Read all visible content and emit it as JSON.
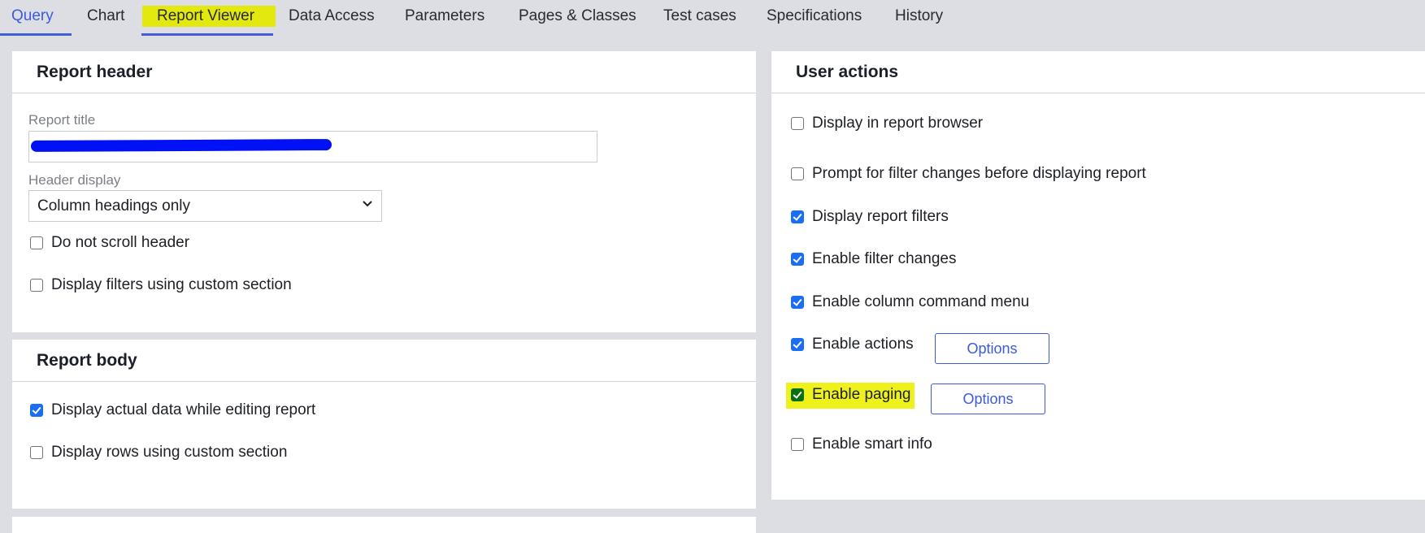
{
  "tabs": [
    {
      "label": "Query",
      "active": true
    },
    {
      "label": "Chart",
      "active": false
    },
    {
      "label": "Report Viewer",
      "active": false,
      "highlighted": true
    },
    {
      "label": "Data Access",
      "active": false
    },
    {
      "label": "Parameters",
      "active": false
    },
    {
      "label": "Pages & Classes",
      "active": false
    },
    {
      "label": "Test cases",
      "active": false
    },
    {
      "label": "Specifications",
      "active": false
    },
    {
      "label": "History",
      "active": false
    }
  ],
  "report_header": {
    "title": "Report header",
    "report_title_label": "Report title",
    "report_title_value": "",
    "header_display_label": "Header display",
    "header_display_value": "Column headings only",
    "checkboxes": [
      {
        "label": "Do not scroll header",
        "checked": false
      },
      {
        "label": "Display filters using custom section",
        "checked": false
      }
    ]
  },
  "report_body": {
    "title": "Report body",
    "checkboxes": [
      {
        "label": "Display actual data while editing report",
        "checked": true
      },
      {
        "label": "Display rows using custom section",
        "checked": false
      }
    ]
  },
  "user_actions": {
    "title": "User actions",
    "checkboxes": [
      {
        "label": "Display in report browser",
        "checked": false
      },
      {
        "label": "Prompt for filter changes before displaying report",
        "checked": false
      },
      {
        "label": "Display report filters",
        "checked": true
      },
      {
        "label": "Enable filter changes",
        "checked": true
      },
      {
        "label": "Enable column command menu",
        "checked": true
      },
      {
        "label": "Enable actions",
        "checked": true
      },
      {
        "label": "Enable paging",
        "checked": true,
        "highlighted": true
      },
      {
        "label": "Enable smart info",
        "checked": false
      }
    ],
    "options_button_label": "Options"
  },
  "colors": {
    "accent": "#3b5bdb",
    "checkbox_checked": "#1a6ef5",
    "highlight": "#eff21a",
    "background": "#dcdee3"
  }
}
